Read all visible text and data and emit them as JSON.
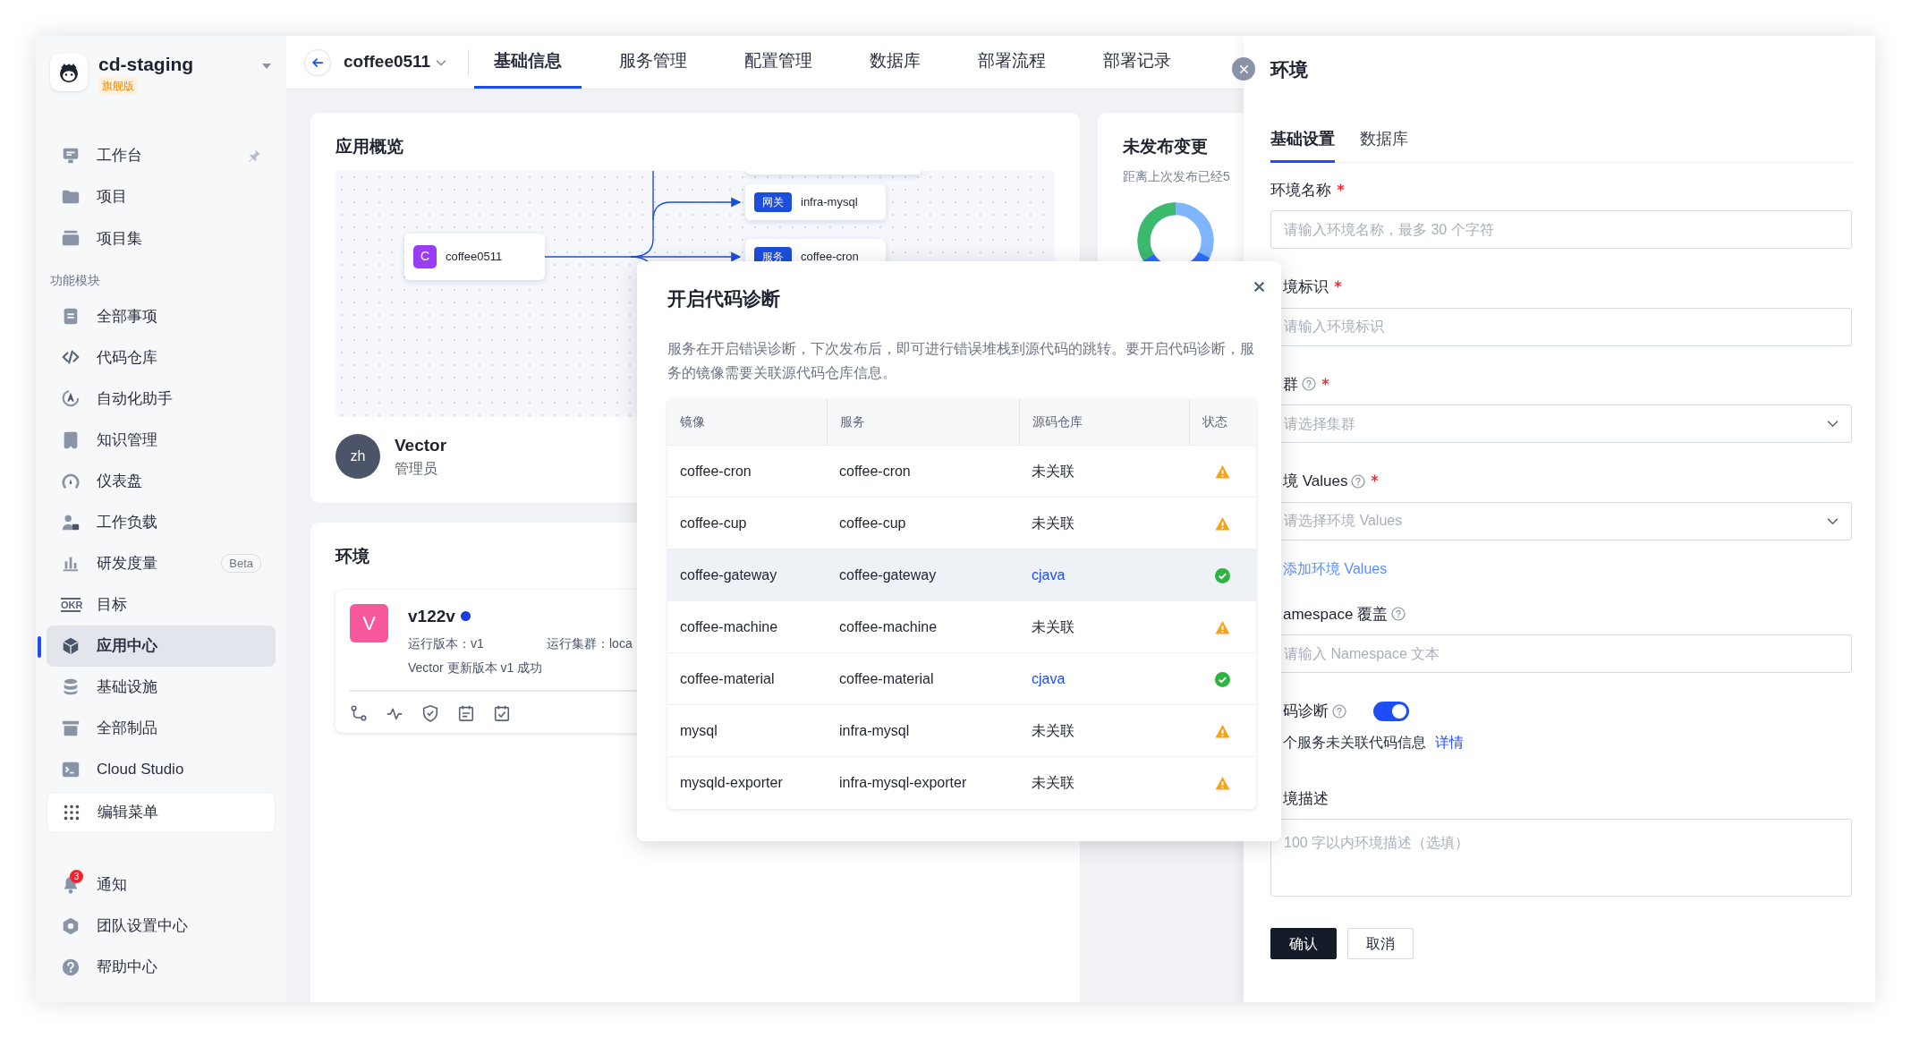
{
  "sidebar": {
    "workspace": "cd-staging",
    "edition": "旗舰版",
    "items": [
      {
        "kind": "nav",
        "label": "工作台",
        "pinned": true,
        "selected": false
      },
      {
        "kind": "nav",
        "label": "项目",
        "pinned": false,
        "selected": false
      },
      {
        "kind": "nav",
        "label": "项目集",
        "pinned": false,
        "selected": false
      },
      {
        "kind": "section",
        "label": "功能模块"
      },
      {
        "kind": "nav",
        "label": "全部事项",
        "pinned": false,
        "selected": false
      },
      {
        "kind": "nav",
        "label": "代码仓库",
        "pinned": false,
        "selected": false
      },
      {
        "kind": "nav",
        "label": "自动化助手",
        "pinned": false,
        "selected": false
      },
      {
        "kind": "nav",
        "label": "知识管理",
        "pinned": false,
        "selected": false
      },
      {
        "kind": "nav",
        "label": "仪表盘",
        "pinned": false,
        "selected": false
      },
      {
        "kind": "nav",
        "label": "工作负载",
        "pinned": false,
        "selected": false
      },
      {
        "kind": "nav",
        "label": "研发度量",
        "pinned": false,
        "selected": false,
        "badge": "Beta"
      },
      {
        "kind": "nav",
        "label": "目标",
        "pinned": false,
        "selected": false,
        "icon_text": "OKR"
      },
      {
        "kind": "nav",
        "label": "应用中心",
        "pinned": false,
        "selected": true
      },
      {
        "kind": "nav",
        "label": "基础设施",
        "pinned": false,
        "selected": false
      },
      {
        "kind": "nav",
        "label": "全部制品",
        "pinned": false,
        "selected": false
      },
      {
        "kind": "nav",
        "label": "Cloud Studio",
        "pinned": false,
        "selected": false
      },
      {
        "kind": "edit",
        "label": "编辑菜单",
        "selected": false
      }
    ],
    "footer_items": [
      {
        "label": "通知",
        "count": "3",
        "selected": false
      },
      {
        "label": "团队设置中心",
        "selected": false
      },
      {
        "label": "帮助中心",
        "selected": false
      }
    ]
  },
  "topbar": {
    "app": "coffee0511",
    "tabs": [
      {
        "label": "基础信息",
        "selected": true
      },
      {
        "label": "服务管理",
        "selected": false
      },
      {
        "label": "配置管理",
        "selected": false
      },
      {
        "label": "数据库",
        "selected": false
      },
      {
        "label": "部署流程",
        "selected": false
      },
      {
        "label": "部署记录",
        "selected": false
      }
    ]
  },
  "overview": {
    "title": "应用概览",
    "diagram": {
      "root": {
        "badge": "C",
        "label": "coffee0511"
      },
      "targets": [
        {
          "tag": "网关",
          "label": "infra-mysql"
        },
        {
          "tag": "服务",
          "label": "coffee-cron"
        }
      ]
    },
    "owner": {
      "avatar": "zh",
      "name": "Vector",
      "role": "管理员"
    }
  },
  "changes": {
    "title": "未发布变更",
    "subtitle": "距离上次发布已经5"
  },
  "environments": {
    "title": "环境",
    "items": [
      {
        "avatar": "V",
        "name": "v122v",
        "version": "运行版本：v1",
        "cluster": "运行集群：loca",
        "event": "Vector 更新版本 v1 成功"
      }
    ]
  },
  "modal": {
    "title": "开启代码诊断",
    "description": "服务在开启错误诊断，下次发布后，即可进行错误堆栈到源代码的跳转。要开启代码诊断，服务的镜像需要关联源代码仓库信息。",
    "columns": [
      "镜像",
      "服务",
      "源码仓库",
      "状态"
    ],
    "rows": [
      {
        "image": "coffee-cron",
        "service": "coffee-cron",
        "repo": "未关联",
        "linked": false,
        "hovered": false
      },
      {
        "image": "coffee-cup",
        "service": "coffee-cup",
        "repo": "未关联",
        "linked": false,
        "hovered": false
      },
      {
        "image": "coffee-gateway",
        "service": "coffee-gateway",
        "repo": "cjava",
        "linked": true,
        "hovered": true
      },
      {
        "image": "coffee-machine",
        "service": "coffee-machine",
        "repo": "未关联",
        "linked": false,
        "hovered": false
      },
      {
        "image": "coffee-material",
        "service": "coffee-material",
        "repo": "cjava",
        "linked": true,
        "hovered": false
      },
      {
        "image": "mysql",
        "service": "infra-mysql",
        "repo": "未关联",
        "linked": false,
        "hovered": false
      },
      {
        "image": "mysqld-exporter",
        "service": "infra-mysql-exporter",
        "repo": "未关联",
        "linked": false,
        "hovered": false
      }
    ]
  },
  "drawer": {
    "title": "环境",
    "tabs": [
      {
        "label": "基础设置",
        "selected": true
      },
      {
        "label": "数据库",
        "selected": false
      }
    ],
    "fields": [
      {
        "kind": "input",
        "label": "环境名称",
        "required": true,
        "help": false,
        "placeholder": "请输入环境名称，最多 30 个字符"
      },
      {
        "kind": "input",
        "label": "境标识",
        "required": true,
        "help": false,
        "placeholder": "请输入环境标识"
      },
      {
        "kind": "select",
        "label": "群",
        "required": true,
        "help": true,
        "placeholder": "请选择集群"
      },
      {
        "kind": "select",
        "label": "境 Values",
        "required": true,
        "help": true,
        "placeholder": "请选择环境 Values",
        "link": "添加环境 Values"
      },
      {
        "kind": "input",
        "label": "amespace 覆盖",
        "required": false,
        "help": true,
        "placeholder": "请输入 Namespace 文本"
      },
      {
        "kind": "toggle",
        "label": "码诊断",
        "required": false,
        "help": true,
        "on": true,
        "note": "个服务未关联代码信息",
        "note_link": "详情"
      },
      {
        "kind": "textarea",
        "label": "境描述",
        "required": false,
        "help": false,
        "placeholder": "100 字以内环境描述（选填）"
      }
    ],
    "buttons": [
      {
        "label": "确认",
        "primary": true
      },
      {
        "label": "取消",
        "primary": false
      }
    ]
  }
}
